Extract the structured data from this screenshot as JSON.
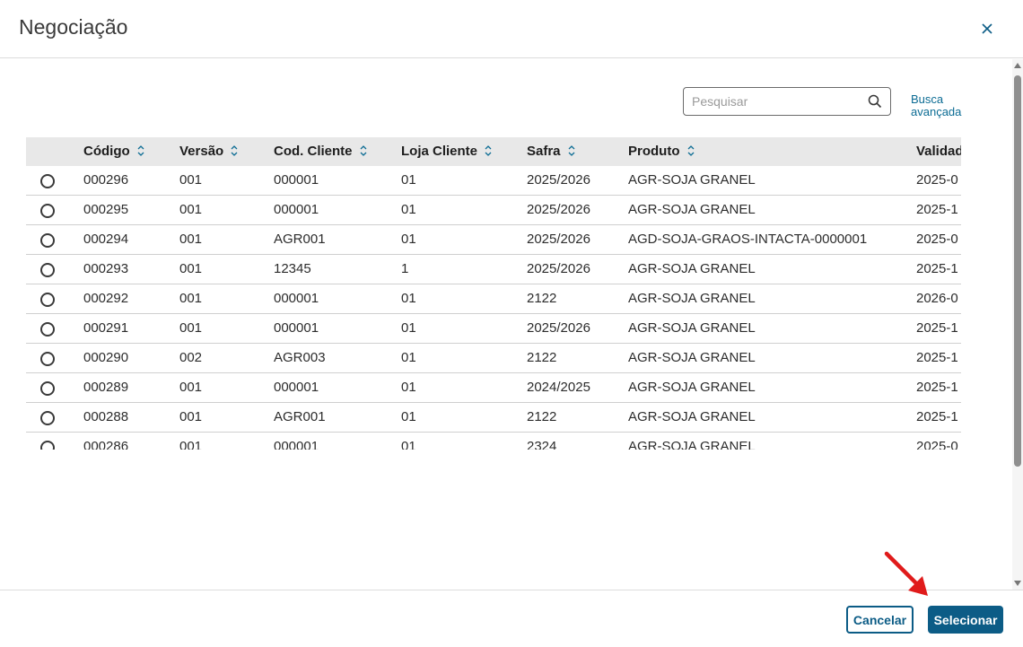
{
  "dialog": {
    "title": "Negociação",
    "close_icon": "close-icon"
  },
  "search": {
    "placeholder": "Pesquisar",
    "icon": "search-icon",
    "advanced_label": "Busca avançada"
  },
  "table": {
    "columns": [
      "Código",
      "Versão",
      "Cod. Cliente",
      "Loja Cliente",
      "Safra",
      "Produto",
      "Validade"
    ],
    "sortable_icon": "sort-up-down-icon",
    "rows": [
      {
        "codigo": "000296",
        "versao": "001",
        "cod_cliente": "000001",
        "loja_cliente": "01",
        "safra": "2025/2026",
        "produto": "AGR-SOJA GRANEL",
        "validade": "2025-0"
      },
      {
        "codigo": "000295",
        "versao": "001",
        "cod_cliente": "000001",
        "loja_cliente": "01",
        "safra": "2025/2026",
        "produto": "AGR-SOJA GRANEL",
        "validade": "2025-1"
      },
      {
        "codigo": "000294",
        "versao": "001",
        "cod_cliente": "AGR001",
        "loja_cliente": "01",
        "safra": "2025/2026",
        "produto": "AGD-SOJA-GRAOS-INTACTA-0000001",
        "validade": "2025-0"
      },
      {
        "codigo": "000293",
        "versao": "001",
        "cod_cliente": "12345",
        "loja_cliente": "1",
        "safra": "2025/2026",
        "produto": "AGR-SOJA GRANEL",
        "validade": "2025-1"
      },
      {
        "codigo": "000292",
        "versao": "001",
        "cod_cliente": "000001",
        "loja_cliente": "01",
        "safra": "2122",
        "produto": "AGR-SOJA GRANEL",
        "validade": "2026-0"
      },
      {
        "codigo": "000291",
        "versao": "001",
        "cod_cliente": "000001",
        "loja_cliente": "01",
        "safra": "2025/2026",
        "produto": "AGR-SOJA GRANEL",
        "validade": "2025-1"
      },
      {
        "codigo": "000290",
        "versao": "002",
        "cod_cliente": "AGR003",
        "loja_cliente": "01",
        "safra": "2122",
        "produto": "AGR-SOJA GRANEL",
        "validade": "2025-1"
      },
      {
        "codigo": "000289",
        "versao": "001",
        "cod_cliente": "000001",
        "loja_cliente": "01",
        "safra": "2024/2025",
        "produto": "AGR-SOJA GRANEL",
        "validade": "2025-1"
      },
      {
        "codigo": "000288",
        "versao": "001",
        "cod_cliente": "AGR001",
        "loja_cliente": "01",
        "safra": "2122",
        "produto": "AGR-SOJA GRANEL",
        "validade": "2025-1"
      },
      {
        "codigo": "000286",
        "versao": "001",
        "cod_cliente": "000001",
        "loja_cliente": "01",
        "safra": "2324",
        "produto": "AGR-SOJA GRANEL",
        "validade": "2025-0"
      }
    ]
  },
  "footer": {
    "cancel_label": "Cancelar",
    "select_label": "Selecionar"
  },
  "colors": {
    "primary": "#0c5c86",
    "link": "#0c6c94",
    "header_row": "#e8e8e8",
    "annotation_arrow": "#e01b1b"
  }
}
